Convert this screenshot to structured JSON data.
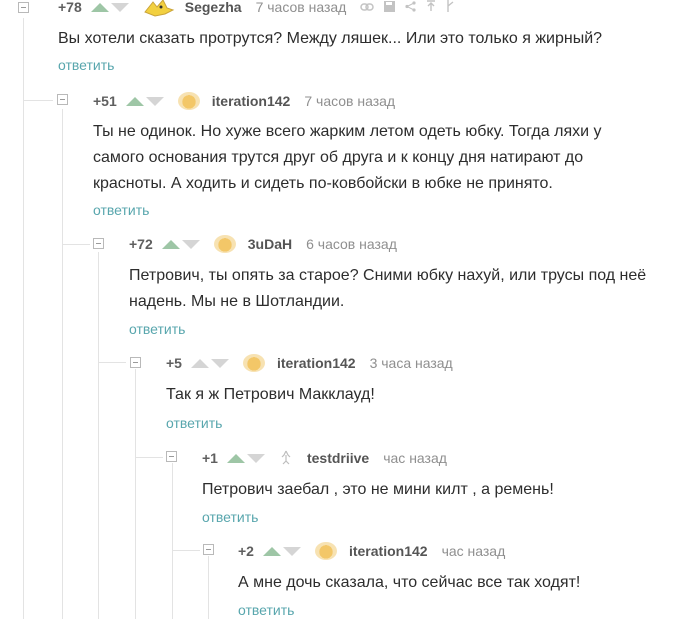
{
  "comments": [
    {
      "rating": "+78",
      "nick": "Segezha",
      "time": "7 часов назад",
      "text": "Вы хотели сказать протрутся? Между ляшек... Или это только я жирный?",
      "reply": "ответить"
    },
    {
      "rating": "+51",
      "nick": "iteration142",
      "time": "7 часов назад",
      "text": "Ты не одинок. Но хуже всего жарким летом одеть юбку. Тогда ляхи у самого основания трутся друг об друга и к концу дня натирают до красноты. А ходить и сидеть по-ковбойски в юбке не принято.",
      "reply": "ответить"
    },
    {
      "rating": "+72",
      "nick": "3uDaH",
      "time": "6 часов назад",
      "text": "Петрович, ты опять за старое? Сними юбку нахуй, или трусы под неё надень. Мы не в Шотландии.",
      "reply": "ответить"
    },
    {
      "rating": "+5",
      "nick": "iteration142",
      "time": "3 часа назад",
      "text": "Так я ж Петрович Макклауд!",
      "reply": "ответить"
    },
    {
      "rating": "+1",
      "nick": "testdriive",
      "time": "час назад",
      "text": "Петрович заебал , это не мини килт , а ремень!",
      "reply": "ответить"
    },
    {
      "rating": "+2",
      "nick": "iteration142",
      "time": "час назад",
      "text": "А мне дочь сказала, что сейчас все так ходят!",
      "reply": "ответить"
    }
  ],
  "icons": {
    "avatar_0": "cartoon-cat-icon",
    "avatar_1": "smiley-avatar-icon",
    "avatar_4": "ghost-avatar-icon",
    "tools": [
      "link-icon",
      "save-icon",
      "share-icon",
      "arrow-up-icon",
      "branch-icon"
    ]
  },
  "colors": {
    "reply_link": "#58a6ad",
    "upvote": "#9ec6a6",
    "downvote": "#d5d5d5"
  }
}
